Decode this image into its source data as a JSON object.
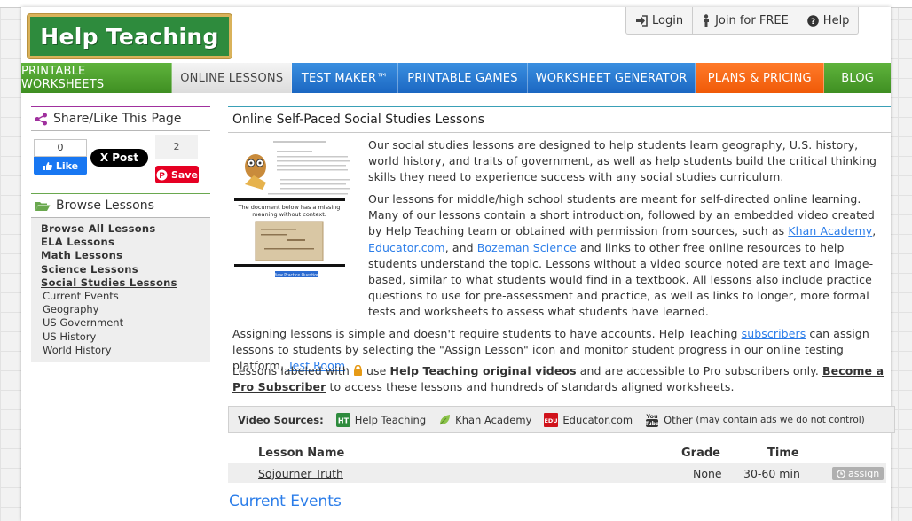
{
  "logo": {
    "text": "Help Teaching"
  },
  "top_links": [
    {
      "label": "Login",
      "icon": "login-icon"
    },
    {
      "label": "Join for FREE",
      "icon": "person-icon"
    },
    {
      "label": "Help",
      "icon": "question-icon"
    }
  ],
  "nav": [
    {
      "label": "PRINTABLE WORKSHEETS",
      "color": "#4a9d2b"
    },
    {
      "label": "ONLINE LESSONS",
      "color": "#e6e6e6"
    },
    {
      "label": "TEST MAKER™",
      "color": "#2377d1"
    },
    {
      "label": "PRINTABLE GAMES",
      "color": "#2377d1"
    },
    {
      "label": "WORKSHEET GENERATOR",
      "color": "#2377d1"
    },
    {
      "label": "PLANS & PRICING",
      "color": "#f56a15"
    },
    {
      "label": "BLOG",
      "color": "#4a9d2b"
    }
  ],
  "share": {
    "title": "Share/Like This Page",
    "fb_count": "0",
    "fb_label": "Like",
    "x_label": "X Post",
    "pin_count": "2",
    "pin_label": "Save"
  },
  "browse": {
    "title": "Browse Lessons",
    "items": [
      "Browse All Lessons",
      "ELA Lessons",
      "Math Lessons",
      "Science Lessons",
      "Social Studies Lessons"
    ],
    "sub_items": [
      "Current Events",
      "Geography",
      "US Government",
      "US History",
      "World History"
    ]
  },
  "main": {
    "title": "Online Self-Paced Social Studies Lessons",
    "thumb_text": "The document below has a missing meaning without context.",
    "p1": "Our social studies lessons are designed to help students learn geography, U.S. history, world history, and traits of government, as well as help students build the critical thinking skills they need to experience success with any social studies curriculum.",
    "p2_a": "Our lessons for middle/high school students are meant for self-directed online learning. Many of our lessons contain a short introduction, followed by an embedded video created by Help Teaching team or obtained with permission from sources, such as ",
    "p2_khan": "Khan Academy",
    "p2_sep1": ", ",
    "p2_edu": "Educator.com",
    "p2_sep2": ", and ",
    "p2_boz": "Bozeman Science",
    "p2_b": " and links to other free online resources to help students understand the topic. Lessons without a video source noted are text and image-based, similar to what students would find in a textbook. All lessons also include practice questions to use for pre-assessment and practice, as well as links to longer, more formal tests and worksheets to assess what students have learned.",
    "p3_a": "Assigning lessons is simple and doesn't require students to have accounts. Help Teaching ",
    "p3_sub": "subscribers",
    "p3_b": " can assign lessons to students by selecting the \"Assign Lesson\" icon and monitor student progress in our online testing platform, ",
    "p3_test": "Test Room",
    "p3_c": ".",
    "p4_a": "Lessons labeled with ",
    "p4_b": " use ",
    "p4_bold": "Help Teaching original videos",
    "p4_c": " and are accessible to Pro subscribers only. ",
    "p4_link": "Become a Pro Subscriber",
    "p4_d": " to access these lessons and hundreds of standards aligned worksheets."
  },
  "video_sources": {
    "label": "Video Sources:",
    "items": [
      {
        "label": "Help Teaching",
        "icon": "ht-icon"
      },
      {
        "label": "Khan Academy",
        "icon": "leaf-icon"
      },
      {
        "label": "Educator.com",
        "icon": "edu-icon"
      },
      {
        "label": "Other",
        "note": "(may contain ads we do not control)",
        "icon": "youtube-icon"
      }
    ]
  },
  "table": {
    "headers": {
      "name": "Lesson Name",
      "grade": "Grade",
      "time": "Time"
    },
    "rows": [
      {
        "name": "Sojourner Truth",
        "grade": "None",
        "time": "30-60 min",
        "action": "assign"
      }
    ]
  },
  "next_section": "Current Events"
}
